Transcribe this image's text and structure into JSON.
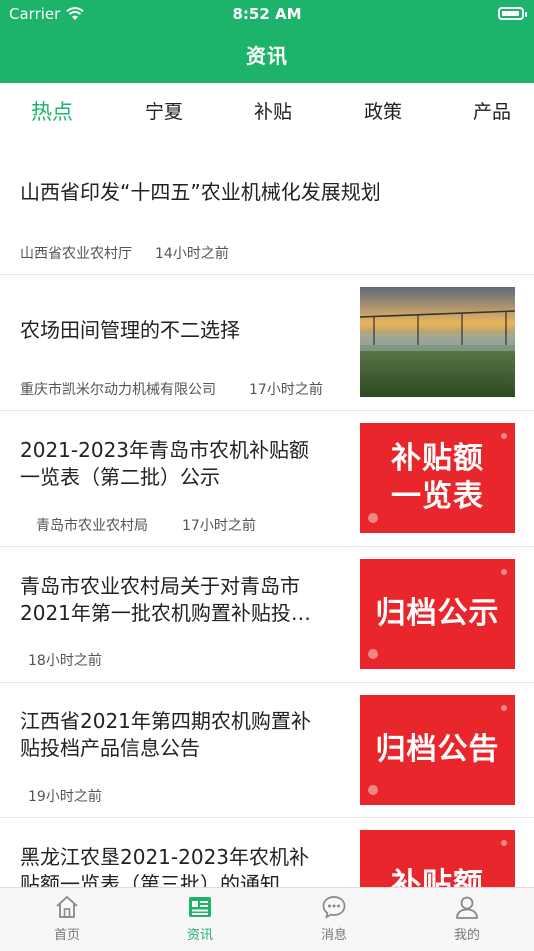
{
  "status_bar": {
    "carrier": "Carrier",
    "time": "8:52 AM"
  },
  "header": {
    "title": "资讯"
  },
  "tabs": [
    {
      "label": "热点",
      "active": true
    },
    {
      "label": "宁夏"
    },
    {
      "label": "补贴"
    },
    {
      "label": "政策"
    },
    {
      "label": "产品"
    }
  ],
  "articles": [
    {
      "title_lines": [
        "山西省印发“十四五”农业机械化发展规划"
      ],
      "source": "山西省农业农村厅",
      "time": "14小时之前"
    },
    {
      "title_lines": [
        "农场田间管理的不二选择"
      ],
      "source": "重庆市凯米尔动力机械有限公司",
      "time": "17小时之前",
      "thumb": "photo"
    },
    {
      "title_lines": [
        "2021-2023年青岛市农机补贴额",
        "一览表（第二批）公示"
      ],
      "source": "青岛市农业农村局",
      "time": "17小时之前",
      "thumb_lines": [
        "补贴额",
        "一览表"
      ]
    },
    {
      "title_lines": [
        "青岛市农业农村局关于对青岛市",
        "2021年第一批农机购置补贴投…"
      ],
      "time": "18小时之前",
      "thumb_lines": [
        "归档公示"
      ]
    },
    {
      "title_lines": [
        "江西省2021年第四期农机购置补",
        "贴投档产品信息公告"
      ],
      "time": "19小时之前",
      "thumb_lines": [
        "归档公告"
      ]
    },
    {
      "title_lines": [
        "黑龙江农垦2021-2023年农机补",
        "贴额一览表（第三批）的通知"
      ],
      "thumb_lines": [
        "补贴额"
      ]
    }
  ],
  "tabbar": [
    {
      "label": "首页",
      "icon": "home-icon"
    },
    {
      "label": "资讯",
      "icon": "news-icon",
      "active": true
    },
    {
      "label": "消息",
      "icon": "message-icon"
    },
    {
      "label": "我的",
      "icon": "profile-icon"
    }
  ],
  "colors": {
    "brand": "#1db36b",
    "thumb_red": "#e8262c"
  }
}
